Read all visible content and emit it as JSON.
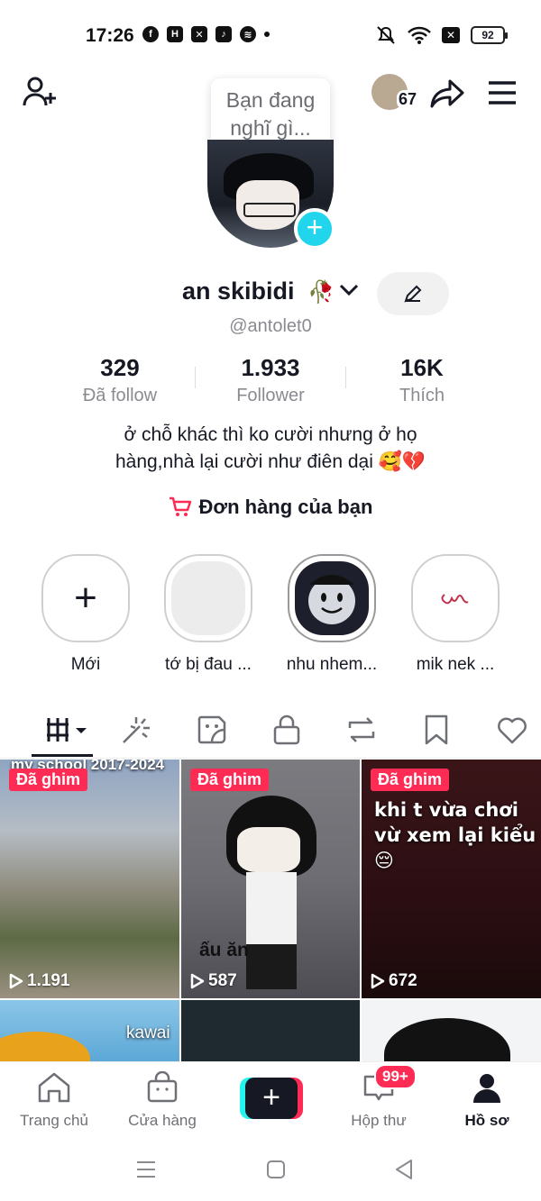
{
  "status_bar": {
    "time": "17:26",
    "battery": "92"
  },
  "header": {
    "friends_count": "67"
  },
  "tooltip": {
    "line1": "Bạn đang",
    "line2": "nghĩ gì..."
  },
  "profile": {
    "name": "an skibidi",
    "handle": "@antolet0",
    "bio_line1": "ở chỗ khác thì ko cười nhưng ở họ",
    "bio_line2": "hàng,nhà lại cười như điên dại 🥰💔",
    "orders_label": "Đơn hàng của bạn"
  },
  "stats": [
    {
      "value": "329",
      "label": "Đã follow"
    },
    {
      "value": "1.933",
      "label": "Follower"
    },
    {
      "value": "16K",
      "label": "Thích"
    }
  ],
  "highlights": [
    {
      "label": "Mới"
    },
    {
      "label": "tớ bị đau ..."
    },
    {
      "label": "nhu nhem..."
    },
    {
      "label": "mik nek ..."
    }
  ],
  "grid": [
    {
      "pinned": "Đã ghim",
      "caption": "my school 2017-2024",
      "views": "1.191"
    },
    {
      "pinned": "Đã ghim",
      "caption": "ấu ăn",
      "views": "587"
    },
    {
      "pinned": "Đã ghim",
      "caption": "khi t vừa chơi vừ xem lại kiểu 😔",
      "views": "672"
    },
    {
      "caption": "kawai"
    }
  ],
  "bottom_nav": {
    "home": "Trang chủ",
    "shop": "Cửa hàng",
    "inbox": "Hộp thư",
    "inbox_badge": "99+",
    "profile": "Hồ sơ"
  },
  "colors": {
    "accent": "#fe2c55",
    "cyan": "#25f4ee",
    "text": "#161823",
    "muted": "#8a8b91"
  }
}
